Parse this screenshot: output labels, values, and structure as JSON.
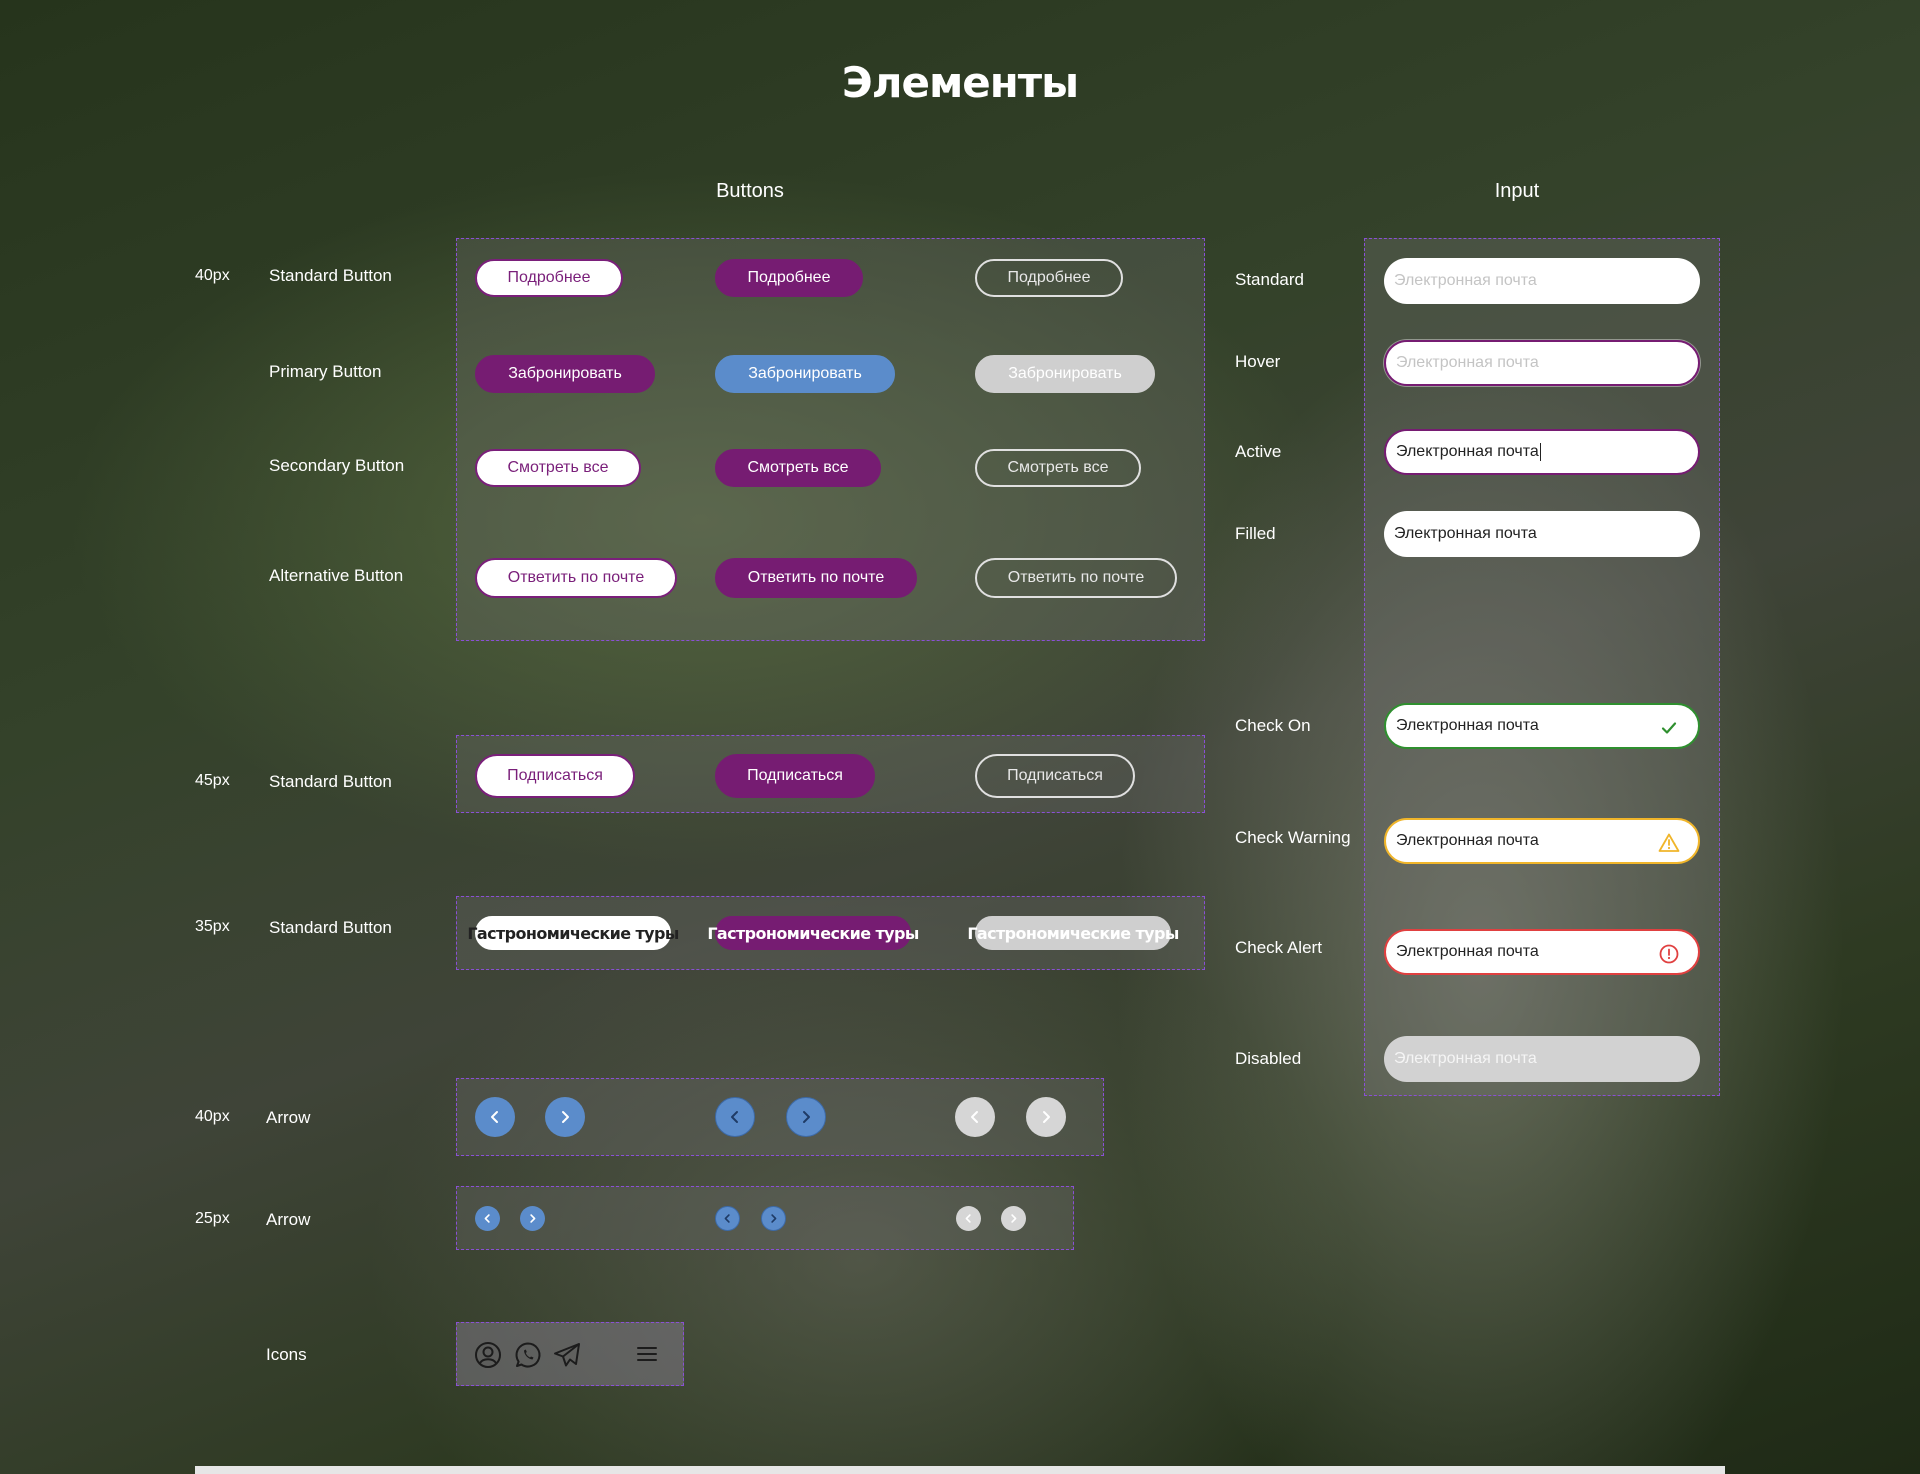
{
  "page_title": "Элементы",
  "sections": {
    "buttons": "Buttons",
    "input": "Input"
  },
  "sizes": {
    "s40": "40px",
    "s45": "45px",
    "s35": "35px",
    "a40": "40px",
    "a25": "25px"
  },
  "row_labels": {
    "standard": "Standard Button",
    "primary": "Primary Button",
    "secondary": "Secondary Button",
    "alternative": "Alternative Button",
    "standard45": "Standard Button",
    "standard35": "Standard Button",
    "arrow40": "Arrow",
    "arrow25": "Arrow",
    "icons": "Icons"
  },
  "buttons": {
    "standard": "Подробнее",
    "primary": "Забронировать",
    "secondary": "Смотреть все",
    "alternative": "Ответить по почте",
    "subscribe": "Подписаться",
    "tag": "Гастрономические туры"
  },
  "input_states": {
    "standard": "Standard",
    "hover": "Hover",
    "active": "Active",
    "filled": "Filled",
    "check_on": "Check On",
    "check_warning": "Check Warning",
    "check_alert": "Check Alert",
    "disabled": "Disabled"
  },
  "input_placeholder": "Электронная почта",
  "input_value": "Электронная почта",
  "colors": {
    "purple": "#761c72",
    "blue": "#5b8ccb",
    "gray": "#cfcfcf",
    "success": "#2f8f2f",
    "warning": "#f0b52a",
    "alert": "#e04040",
    "panel_border": "#8a4fd6"
  },
  "icons": [
    "user-circle-icon",
    "whatsapp-icon",
    "telegram-icon",
    "menu-icon"
  ]
}
